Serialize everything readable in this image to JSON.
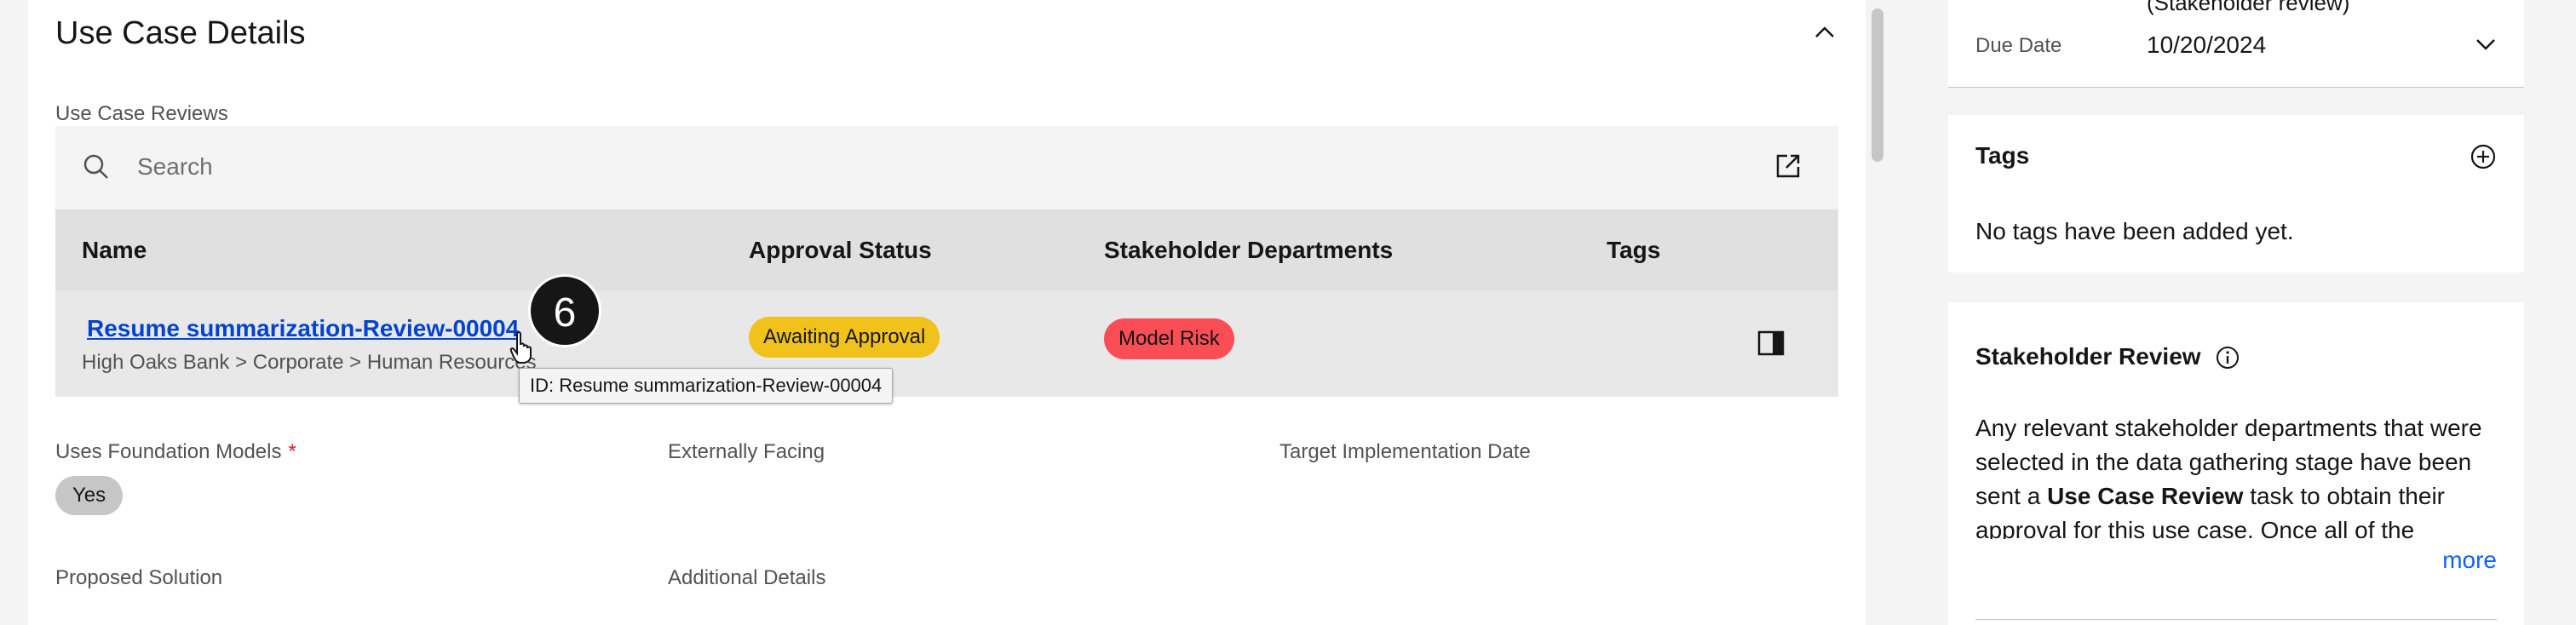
{
  "use_case_details": {
    "title": "Use Case Details",
    "reviews_label": "Use Case Reviews",
    "search_placeholder": "Search",
    "columns": [
      "Name",
      "Approval Status",
      "Stakeholder Departments",
      "Tags"
    ],
    "row": {
      "name": "Resume summarization-Review-00004",
      "path": "High Oaks Bank > Corporate > Human Resources",
      "approval_status": "Awaiting Approval",
      "department": "Model Risk"
    },
    "tooltip": "ID: Resume summarization-Review-00004",
    "step_badge": "6",
    "fields": {
      "uses_foundation_models": "Uses Foundation Models",
      "required_mark": "*",
      "uses_foundation_models_value": "Yes",
      "externally_facing": "Externally Facing",
      "target_implementation_date": "Target Implementation Date",
      "proposed_solution": "Proposed Solution",
      "additional_details": "Additional Details"
    }
  },
  "right_panel": {
    "clipped_text": "(Stakeholder review)",
    "due_date_label": "Due Date",
    "due_date_value": "10/20/2024",
    "tags_title": "Tags",
    "tags_empty": "No tags have been added yet.",
    "stakeholder_title": "Stakeholder Review",
    "stakeholder_desc_1": "Any relevant stakeholder departments that were selected in the data gathering stage have been sent a ",
    "stakeholder_desc_bold": "Use Case Review",
    "stakeholder_desc_2": " task to obtain their approval for this use case. Once all of the",
    "more_link": "more"
  },
  "colors": {
    "link": "#0043ce",
    "awaiting_approval": "#f1c21b",
    "model_risk": "#fa4d56",
    "yes_tag": "#c6c6c6"
  }
}
